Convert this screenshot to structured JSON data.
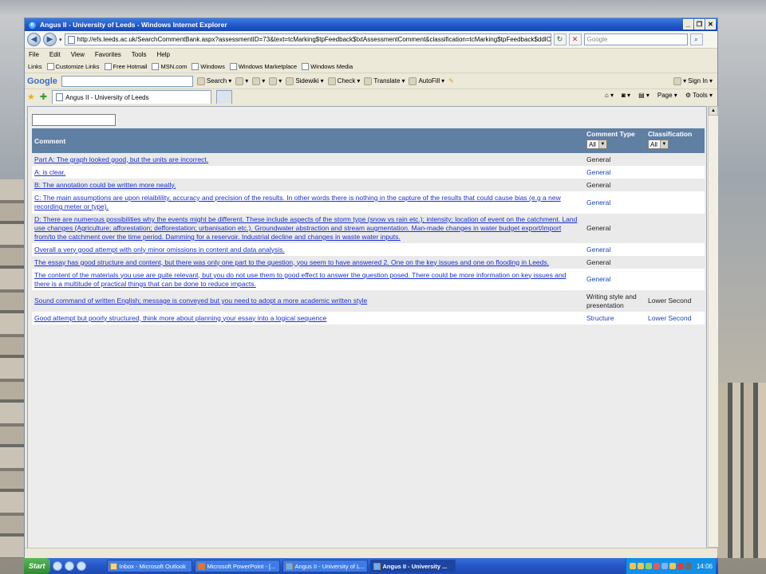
{
  "window": {
    "title": "Angus II - University of Leeds - Windows Internet Explorer",
    "buttons": [
      "_",
      "❐",
      "✕"
    ]
  },
  "address_bar": {
    "url": "http://efs.leeds.ac.uk/SearchCommentBank.aspx?assessmentID=73&text=tcMarking$tpFeedback$txtAssessmentComment&classification=tcMarking$tpFeedback$ddlClassificationi",
    "search_placeholder": "Google"
  },
  "menu": [
    "File",
    "Edit",
    "View",
    "Favorites",
    "Tools",
    "Help"
  ],
  "links_bar": {
    "label": "Links",
    "items": [
      "Customize Links",
      "Free Hotmail",
      "MSN.com",
      "Windows",
      "Windows Marketplace",
      "Windows Media"
    ]
  },
  "google_toolbar": {
    "logo": "Google",
    "items": [
      "Search",
      "Sidewiki",
      "Check",
      "Translate",
      "AutoFill",
      "Sign In"
    ]
  },
  "tabs_bar": {
    "tab_title": "Angus II - University of Leeds",
    "page_label": "Page",
    "tools_label": "Tools"
  },
  "grid": {
    "headers": {
      "comment": "Comment",
      "type": "Comment Type",
      "classification": "Classification",
      "type_filter": "All",
      "class_filter": "All"
    },
    "rows": [
      {
        "comment": "Part A: The graph looked good, but the units are incorrect.",
        "type": "General",
        "classification": ""
      },
      {
        "comment": "A: is clear.",
        "type": "General",
        "classification": ""
      },
      {
        "comment": "B: The annotation could be written more neatly.",
        "type": "General",
        "classification": ""
      },
      {
        "comment": "C: The main assumptions are upon relaiblility, accuracy and precision of the results. In other words there is nothing in the capture of the results that could cause bias (e.g a new recording meter or type).",
        "type": "General",
        "classification": ""
      },
      {
        "comment": "D: There are numerous possibilities why the events might be different. These include aspects of the storm type (snow vs rain etc.); intensity; location of event on the catchment. Land use changes (Agriculture; afforestation; defforestation; urbanisation etc.). Groundwater abstraction and stream augmentation. Man-made changes in water budget export/import from/to the catchment over the time period. Damming for a reservoir. Industrial decline and changes in waste water inputs.",
        "type": "General",
        "classification": ""
      },
      {
        "comment": "Overall a very good attempt with only minor omissions in content and data analysis.",
        "type": "General",
        "classification": ""
      },
      {
        "comment": "The essay has good structure and content, but there was only one part to the question, you seem to have answered 2. One on the key issues and one on flooding in Leeds.",
        "type": "General",
        "classification": ""
      },
      {
        "comment": "The content of the materials you use are quite relevant, but you do not use them to good effect to answer the question posed. There could be more information on key issues and there is a multitude of practical things that can be done to reduce impacts.",
        "type": "General",
        "classification": ""
      },
      {
        "comment": "Sound command of written English; message is conveyed but you need to adopt a more academic written style",
        "type": "Writing style and presentation",
        "classification": "Lower Second"
      },
      {
        "comment": "Good attempt but poorly structured, think more about planning your essay into a logical sequence",
        "type": "Structure",
        "classification": "Lower Second"
      }
    ]
  },
  "taskbar": {
    "start": "Start",
    "tasks": [
      "Inbox - Microsoft Outlook",
      "Microsoft PowerPoint - [...",
      "Angus II - University of L...",
      "Angus II - University ..."
    ],
    "clock": "14:06"
  }
}
